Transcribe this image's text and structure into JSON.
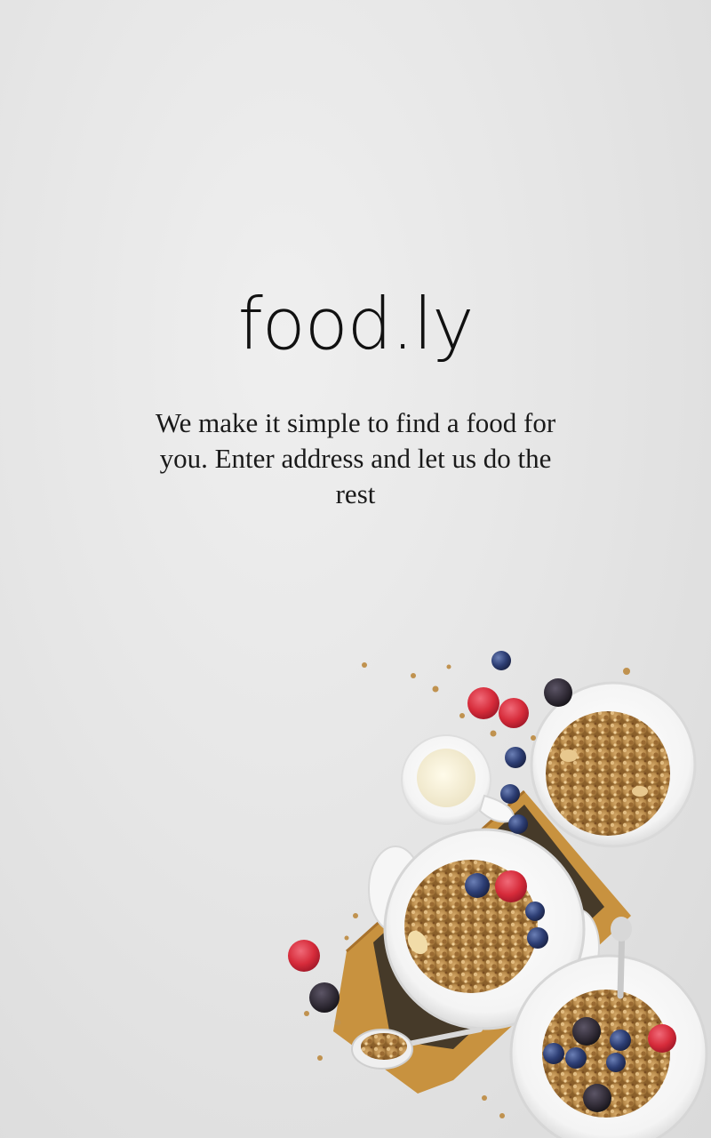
{
  "app": {
    "logo_text": "food.ly",
    "tagline": "We make it simple to find a food for you. Enter address and let us do the rest"
  },
  "hero_image": {
    "icon": "breakfast-granola-illustration",
    "colors": {
      "background": "#e6e6e6",
      "bowl": "#ffffff",
      "granola": "#b88a4a",
      "board": "#c8923f",
      "blueberry": "#2d3e74",
      "raspberry": "#d62b3a",
      "blackberry": "#2b2630",
      "milk": "#f7f2e0"
    }
  }
}
